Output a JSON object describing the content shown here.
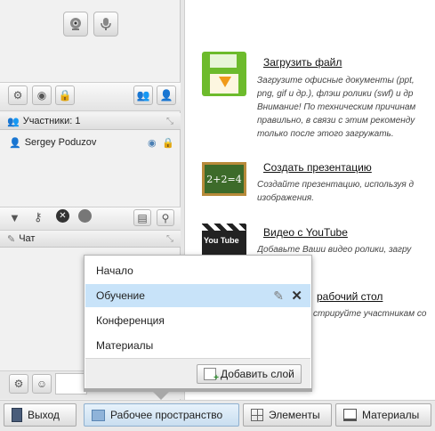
{
  "participants": {
    "header": "Участники: 1",
    "user_name": "Sergey Poduzov"
  },
  "chat": {
    "header": "Чат"
  },
  "actions": [
    {
      "title": "Загрузить файл",
      "desc": [
        "Загрузите офисные документы (ppt,",
        "png, gif и др.), флэш ролики (swf) и др",
        "Внимание! По техническим причинам",
        "правильно, в связи с этим рекоменду",
        "только после этого загружать."
      ]
    },
    {
      "title": "Создать презентацию",
      "desc": [
        "Создайте презентацию, используя д",
        "изображения."
      ],
      "board_text": "2+2=4"
    },
    {
      "title": "Видео с YouTube",
      "desc": [
        "Добавьте Ваши видео ролики, загру"
      ],
      "logo_text": "You Tube"
    },
    {
      "title": "рабочий стол",
      "desc": [
        "стрируйте участникам со"
      ]
    }
  ],
  "layers_menu": {
    "items": [
      "Начало",
      "Обучение",
      "Конференция",
      "Материалы"
    ],
    "selected": "Обучение",
    "add_layer_label": "Добавить слой"
  },
  "bottom_tabs": {
    "exit": "Выход",
    "workspace": "Рабочее пространство",
    "elements": "Элементы",
    "materials": "Материалы"
  }
}
